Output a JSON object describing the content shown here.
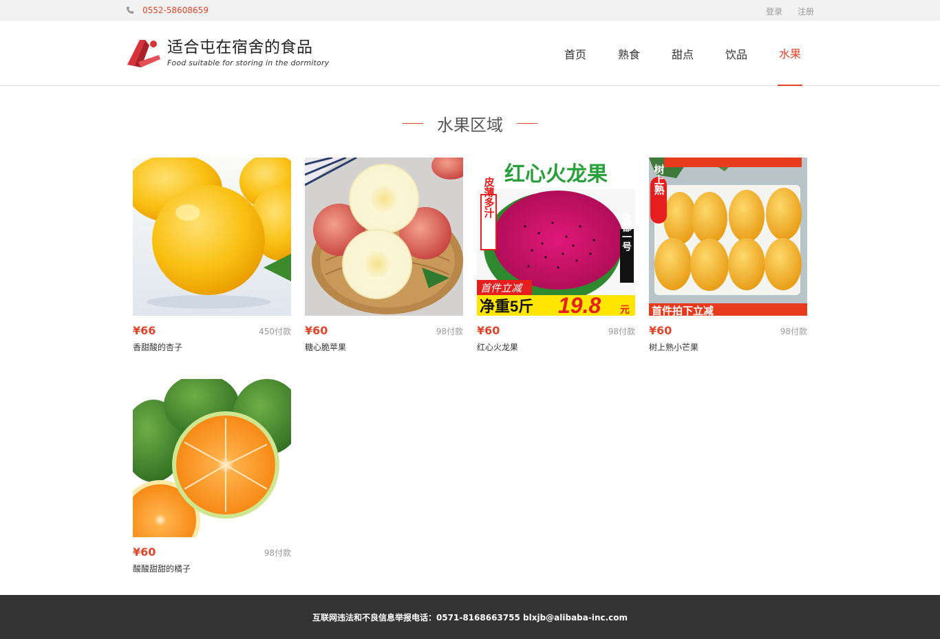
{
  "topbar": {
    "phone": "0552-58608659",
    "login": "登录",
    "register": "注册"
  },
  "logo": {
    "title": "适合屯在宿舍的食品",
    "subtitle": "Food suitable for storing in the dormitory"
  },
  "nav": {
    "items": [
      "首页",
      "熟食",
      "甜点",
      "饮品",
      "水果"
    ],
    "active": "水果"
  },
  "section": {
    "title": "水果区域"
  },
  "products": [
    {
      "price": "¥66",
      "sold": "450付款",
      "name": "香甜酸的杏子",
      "image": "yellow-apricots"
    },
    {
      "price": "¥60",
      "sold": "98付款",
      "name": "糖心脆苹果",
      "image": "sliced-apples"
    },
    {
      "price": "¥60",
      "sold": "98付款",
      "name": "红心火龙果",
      "image": "dragon-fruit-promo"
    },
    {
      "price": "¥60",
      "sold": "98付款",
      "name": "树上熟小芒果",
      "image": "mangoes-box"
    },
    {
      "price": "¥60",
      "sold": "98付款",
      "name": "酸酸甜甜的橘子",
      "image": "green-oranges"
    }
  ],
  "promo_texts": {
    "dragon_title": "红心火龙果",
    "dragon_side_left": "皮薄多汁",
    "dragon_side_right": "金都一号",
    "dragon_banner": "首件立减",
    "dragon_weight": "净重5斤",
    "dragon_price": "19.8",
    "dragon_unit": "元",
    "mango_tag": "树上熟",
    "mango_banner": "首件拍下立减"
  },
  "footer": {
    "text": "互联网违法和不良信息举报电话：0571-8168663755 blxjb@alibaba-inc.com"
  },
  "colors": {
    "accent": "#e0442a",
    "footer_bg": "#333333",
    "topbar_bg": "#f2f2f2"
  }
}
